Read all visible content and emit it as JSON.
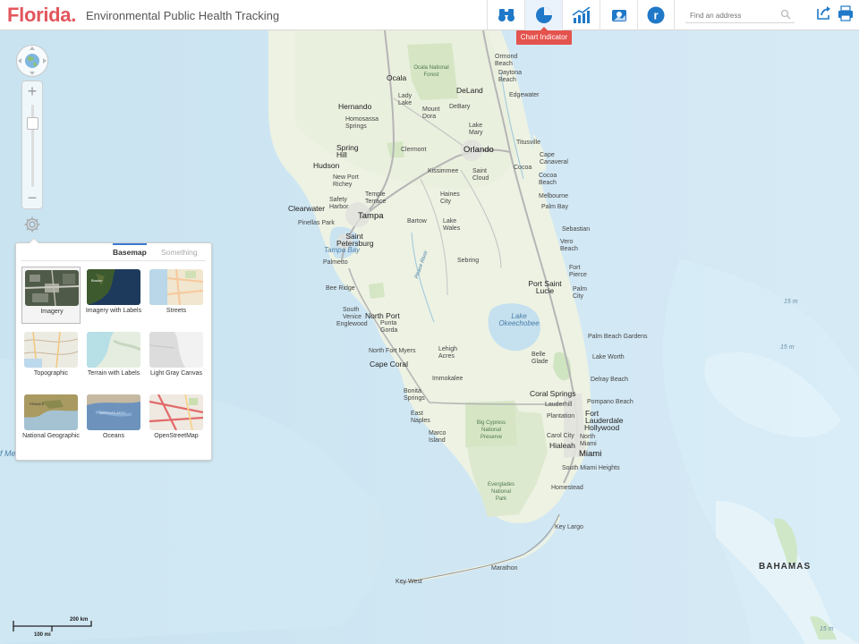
{
  "header": {
    "logo_state": "Florida.",
    "logo_subtitle": "Environmental Public Health Tracking",
    "nav_buttons": [
      {
        "name": "binoculars-icon"
      },
      {
        "name": "pie-chart-icon"
      },
      {
        "name": "trend-chart-icon"
      },
      {
        "name": "map-marker-icon"
      },
      {
        "name": "r-icon"
      }
    ],
    "search_placeholder": "Find an address",
    "tooltip": "Chart Indicator"
  },
  "panel": {
    "tabs": [
      "Basemap",
      "Something"
    ],
    "basemaps": [
      {
        "label": "Imagery",
        "selected": true
      },
      {
        "label": "Imagery with Labels",
        "selected": false
      },
      {
        "label": "Streets",
        "selected": false
      },
      {
        "label": "Topographic",
        "selected": false
      },
      {
        "label": "Terrain with Labels",
        "selected": false
      },
      {
        "label": "Light Gray Canvas",
        "selected": false
      },
      {
        "label": "National Geographic",
        "selected": false
      },
      {
        "label": "Oceans",
        "selected": false
      },
      {
        "label": "OpenStreetMap",
        "selected": false
      }
    ]
  },
  "scale": {
    "km": "200 km",
    "mi": "100 mi"
  },
  "map_labels": {
    "ocala": "Ocala",
    "ocala_forest": "Ocala National Forest",
    "ormond_beach": "Ormond Beach",
    "daytona_beach": "Daytona Beach",
    "deland": "DeLand",
    "edgewater": "Edgewater",
    "lady_lake": "Lady Lake",
    "hernando": "Hernando",
    "mount_dora": "Mount Dora",
    "debary": "DeBary",
    "homosassa": "Homosassa Springs",
    "lake_mary": "Lake Mary",
    "titusville": "Titusville",
    "spring_hill": "Spring Hill",
    "clermont": "Clermont",
    "orlando": "Orlando",
    "cape_canaveral": "Cape Canaveral",
    "hudson": "Hudson",
    "kissimmee": "Kissimmee",
    "saint_cloud": "Saint Cloud",
    "cocoa": "Cocoa",
    "cocoa_beach": "Cocoa Beach",
    "new_port_richey": "New Port Richey",
    "temple_terrace": "Temple Terrace",
    "haines_city": "Haines City",
    "melbourne": "Melbourne",
    "clearwater": "Clearwater",
    "safety_harbor": "Safety Harbor",
    "palm_bay": "Palm Bay",
    "pinellas_park": "Pinellas Park",
    "tampa": "Tampa",
    "bartow": "Bartow",
    "lake_wales": "Lake Wales",
    "sebastian": "Sebastian",
    "saint_petersburg": "Saint Petersburg",
    "tampa_bay": "Tampa Bay",
    "vero_beach": "Vero Beach",
    "palmetto": "Palmetto",
    "sebring": "Sebring",
    "fort_pierce": "Fort Pierce",
    "peace_river": "Peace River",
    "bee_ridge": "Bee Ridge",
    "port_saint_lucie": "Port Saint Lucie",
    "palm_city": "Palm City",
    "south_venice": "South Venice",
    "north_port": "North Port",
    "englewood": "Englewood",
    "punta_gorda": "Punta Gorda",
    "lake_okeechobee": "Lake Okeechobee",
    "palm_beach_gardens": "Palm Beach Gardens",
    "north_fort_myers": "North Fort Myers",
    "lehigh_acres": "Lehigh Acres",
    "belle_glade": "Belle Glade",
    "lake_worth": "Lake Worth",
    "cape_coral": "Cape Coral",
    "delray_beach": "Delray Beach",
    "immokalee": "Immokalee",
    "bonita_springs": "Bonita Springs",
    "coral_springs": "Coral Springs",
    "pompano_beach": "Pompano Beach",
    "big_cypress": "Big Cypress National Preserve",
    "lauderhill": "Lauderhill",
    "fort_lauderdale": "Fort Lauderdale",
    "east_naples": "East Naples",
    "plantation": "Plantation",
    "hollywood": "Hollywood",
    "marco_island": "Marco Island",
    "carol_city": "Carol City",
    "north_miami": "North Miami",
    "hialeah": "Hialeah",
    "miami": "Miami",
    "south_miami_heights": "South Miami Heights",
    "homestead": "Homestead",
    "everglades": "Everglades National Park",
    "key_largo": "Key Largo",
    "marathon": "Marathon",
    "key_west": "Key West",
    "bahamas": "BAHAMAS",
    "depth_1": "15 m",
    "depth_2": "15 m",
    "depth_3": "15 m",
    "gulf_fragment": "f Me"
  }
}
